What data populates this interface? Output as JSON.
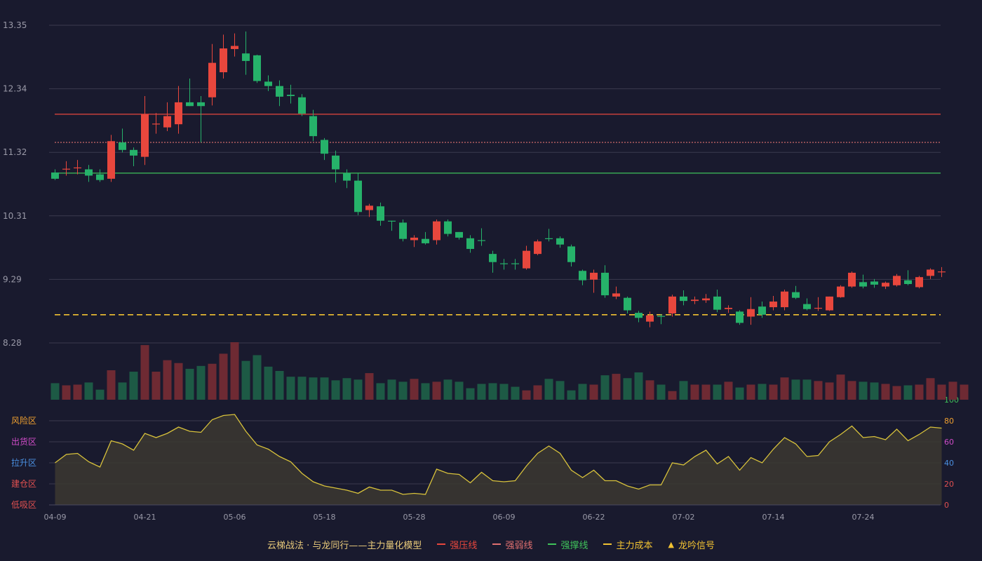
{
  "chart_data": {
    "type": "candlestick",
    "price_axis": {
      "ticks": [
        "13.35",
        "12.34",
        "11.32",
        "10.31",
        "9.29",
        "8.28"
      ],
      "ylim": [
        8.28,
        13.35
      ]
    },
    "x_ticks": [
      {
        "label": "04-09",
        "index": 0
      },
      {
        "label": "04-21",
        "index": 8
      },
      {
        "label": "05-06",
        "index": 16
      },
      {
        "label": "05-18",
        "index": 24
      },
      {
        "label": "05-28",
        "index": 32
      },
      {
        "label": "06-09",
        "index": 40
      },
      {
        "label": "06-22",
        "index": 48
      },
      {
        "label": "07-02",
        "index": 56
      },
      {
        "label": "07-14",
        "index": 64
      },
      {
        "label": "07-24",
        "index": 72
      }
    ],
    "candles": [
      [
        11.0,
        10.9,
        11.05,
        10.88,
        "dn"
      ],
      [
        11.05,
        11.06,
        11.18,
        10.95,
        "up"
      ],
      [
        11.07,
        11.08,
        11.2,
        10.97,
        "up"
      ],
      [
        11.05,
        10.95,
        11.12,
        10.85,
        "dn"
      ],
      [
        10.97,
        10.88,
        11.05,
        10.85,
        "dn"
      ],
      [
        10.9,
        11.5,
        11.6,
        10.85,
        "up"
      ],
      [
        11.48,
        11.36,
        11.7,
        11.32,
        "dn"
      ],
      [
        11.36,
        11.27,
        11.4,
        11.1,
        "dn"
      ],
      [
        11.25,
        11.93,
        12.22,
        11.12,
        "up"
      ],
      [
        11.77,
        11.78,
        11.95,
        11.62,
        "up"
      ],
      [
        11.72,
        11.9,
        12.12,
        11.66,
        "up"
      ],
      [
        11.77,
        12.12,
        12.38,
        11.62,
        "up"
      ],
      [
        12.12,
        12.06,
        12.5,
        12.06,
        "dn"
      ],
      [
        12.12,
        12.06,
        12.22,
        11.48,
        "dn"
      ],
      [
        12.2,
        12.75,
        13.05,
        12.07,
        "up"
      ],
      [
        12.6,
        12.98,
        13.2,
        12.5,
        "up"
      ],
      [
        12.97,
        13.02,
        13.22,
        12.85,
        "up"
      ],
      [
        12.9,
        12.78,
        13.25,
        12.56,
        "dn"
      ],
      [
        12.87,
        12.46,
        12.88,
        12.43,
        "dn"
      ],
      [
        12.45,
        12.38,
        12.55,
        12.3,
        "dn"
      ],
      [
        12.38,
        12.21,
        12.47,
        12.06,
        "dn"
      ],
      [
        12.24,
        12.22,
        12.4,
        12.1,
        "dn"
      ],
      [
        12.2,
        11.94,
        12.25,
        11.9,
        "dn"
      ],
      [
        11.9,
        11.58,
        12.0,
        11.5,
        "dn"
      ],
      [
        11.52,
        11.3,
        11.55,
        11.2,
        "dn"
      ],
      [
        11.27,
        11.05,
        11.35,
        10.84,
        "dn"
      ],
      [
        10.99,
        10.87,
        11.05,
        10.75,
        "dn"
      ],
      [
        10.87,
        10.37,
        10.99,
        10.32,
        "dn"
      ],
      [
        10.4,
        10.47,
        10.5,
        10.29,
        "up"
      ],
      [
        10.46,
        10.23,
        10.52,
        10.15,
        "dn"
      ],
      [
        10.23,
        10.22,
        10.23,
        10.07,
        "dn"
      ],
      [
        10.2,
        9.94,
        10.25,
        9.9,
        "dn"
      ],
      [
        9.92,
        9.96,
        10.0,
        9.81,
        "up"
      ],
      [
        9.94,
        9.87,
        10.05,
        9.85,
        "dn"
      ],
      [
        9.92,
        10.22,
        10.25,
        9.85,
        "up"
      ],
      [
        10.22,
        10.02,
        10.25,
        9.98,
        "dn"
      ],
      [
        10.05,
        9.96,
        10.05,
        9.93,
        "dn"
      ],
      [
        9.95,
        9.78,
        10.0,
        9.72,
        "dn"
      ],
      [
        9.92,
        9.92,
        10.11,
        9.83,
        "dn"
      ],
      [
        9.7,
        9.57,
        9.75,
        9.4,
        "dn"
      ],
      [
        9.55,
        9.55,
        9.62,
        9.45,
        "dn"
      ],
      [
        9.55,
        9.55,
        9.62,
        9.45,
        "dn"
      ],
      [
        9.47,
        9.75,
        9.83,
        9.45,
        "up"
      ],
      [
        9.7,
        9.9,
        9.93,
        9.68,
        "up"
      ],
      [
        9.95,
        9.94,
        10.1,
        9.9,
        "dn"
      ],
      [
        9.95,
        9.85,
        9.98,
        9.8,
        "dn"
      ],
      [
        9.82,
        9.57,
        9.85,
        9.5,
        "dn"
      ],
      [
        9.43,
        9.28,
        9.45,
        9.2,
        "dn"
      ],
      [
        9.29,
        9.4,
        9.45,
        9.08,
        "up"
      ],
      [
        9.4,
        9.04,
        9.52,
        9.0,
        "dn"
      ],
      [
        9.02,
        9.07,
        9.18,
        8.98,
        "up"
      ],
      [
        9.0,
        8.8,
        9.02,
        8.75,
        "dn"
      ],
      [
        8.76,
        8.68,
        8.79,
        8.61,
        "dn"
      ],
      [
        8.62,
        8.72,
        8.78,
        8.53,
        "up"
      ],
      [
        8.71,
        8.7,
        8.74,
        8.58,
        "dn"
      ],
      [
        8.75,
        9.02,
        9.05,
        8.7,
        "up"
      ],
      [
        8.95,
        9.02,
        9.12,
        8.88,
        "dn"
      ],
      [
        8.95,
        8.97,
        9.02,
        8.9,
        "up"
      ],
      [
        8.96,
        8.99,
        9.06,
        8.92,
        "up"
      ],
      [
        9.02,
        8.81,
        9.13,
        8.77,
        "dn"
      ],
      [
        8.82,
        8.84,
        8.88,
        8.76,
        "up"
      ],
      [
        8.78,
        8.6,
        8.8,
        8.57,
        "dn"
      ],
      [
        8.7,
        8.82,
        9.01,
        8.57,
        "up"
      ],
      [
        8.73,
        8.86,
        8.94,
        8.68,
        "dn"
      ],
      [
        8.85,
        8.94,
        9.03,
        8.8,
        "up"
      ],
      [
        8.85,
        9.1,
        9.13,
        8.8,
        "up"
      ],
      [
        9.09,
        9.0,
        9.19,
        8.98,
        "dn"
      ],
      [
        8.9,
        8.82,
        8.99,
        8.8,
        "dn"
      ],
      [
        8.83,
        8.84,
        9.01,
        8.79,
        "up"
      ],
      [
        8.8,
        9.02,
        9.02,
        8.79,
        "up"
      ],
      [
        9.01,
        9.18,
        9.2,
        9.0,
        "up"
      ],
      [
        9.18,
        9.4,
        9.42,
        9.16,
        "up"
      ],
      [
        9.25,
        9.18,
        9.37,
        9.15,
        "dn"
      ],
      [
        9.26,
        9.21,
        9.3,
        9.16,
        "dn"
      ],
      [
        9.18,
        9.24,
        9.26,
        9.14,
        "up"
      ],
      [
        9.2,
        9.35,
        9.38,
        9.18,
        "up"
      ],
      [
        9.28,
        9.22,
        9.44,
        9.2,
        "dn"
      ],
      [
        9.17,
        9.33,
        9.35,
        9.15,
        "up"
      ],
      [
        9.35,
        9.45,
        9.47,
        9.3,
        "up"
      ],
      [
        9.41,
        9.42,
        9.49,
        9.33,
        "up"
      ]
    ],
    "volume": [
      23,
      20,
      21,
      24,
      14,
      41,
      24,
      39,
      76,
      39,
      55,
      51,
      43,
      47,
      50,
      64,
      80,
      54,
      62,
      46,
      40,
      32,
      32,
      31,
      31,
      27,
      30,
      28,
      37,
      23,
      28,
      25,
      29,
      23,
      25,
      28,
      25,
      16,
      22,
      23,
      22,
      18,
      13,
      20,
      29,
      26,
      13,
      22,
      21,
      34,
      36,
      30,
      38,
      27,
      21,
      12,
      26,
      21,
      21,
      21,
      25,
      17,
      21,
      22,
      21,
      31,
      28,
      28,
      26,
      24,
      35,
      26,
      25,
      24,
      22,
      19,
      20,
      21,
      30,
      21,
      25,
      21
    ],
    "indicator": {
      "axis_ticks": [
        "100",
        "80",
        "60",
        "40",
        "20",
        "0"
      ],
      "zones": [
        "风险区",
        "出货区",
        "拉升区",
        "建仓区",
        "低吸区"
      ],
      "values": [
        40,
        48,
        49,
        41,
        36,
        61,
        58,
        52,
        68,
        64,
        68,
        74,
        70,
        69,
        81,
        85,
        86,
        70,
        57,
        53,
        46,
        41,
        30,
        22,
        18,
        16,
        14,
        11,
        17,
        14,
        14,
        10,
        11,
        10,
        34,
        30,
        29,
        21,
        31,
        23,
        22,
        23,
        37,
        49,
        56,
        49,
        33,
        26,
        33,
        23,
        23,
        18,
        15,
        19,
        19,
        40,
        38,
        46,
        52,
        39,
        46,
        33,
        45,
        40,
        53,
        64,
        58,
        46,
        47,
        60,
        67,
        75,
        64,
        65,
        62,
        72,
        61,
        67,
        74,
        73
      ]
    },
    "lines": [
      {
        "key": "strong_pressure",
        "value": 11.93,
        "color": "#e8473d",
        "style": "solid"
      },
      {
        "key": "strong_weak",
        "value": 11.48,
        "color": "#e07070",
        "style": "dotted"
      },
      {
        "key": "strong_support",
        "value": 10.99,
        "color": "#3fc25a",
        "style": "solid"
      },
      {
        "key": "main_cost",
        "value": 8.73,
        "color": "#f1c232",
        "style": "dashed"
      }
    ],
    "legend": {
      "title": "云梯战法 · 与龙同行——主力量化模型",
      "items": [
        {
          "label": "强压线",
          "color": "#e8473d",
          "style": "solid"
        },
        {
          "label": "强弱线",
          "color": "#e07070",
          "style": "dashed"
        },
        {
          "label": "强撑线",
          "color": "#3fc25a",
          "style": "solid"
        },
        {
          "label": "主力成本",
          "color": "#f1c232",
          "style": "dashed"
        },
        {
          "label": "龙吟信号",
          "color": "#f1c232",
          "style": "triangle"
        }
      ]
    },
    "colors": {
      "up": "#e8473d",
      "down": "#26b26a",
      "vol_up": "#6e2a33",
      "vol_down": "#1d5a45",
      "indicator_line": "#d8c23b",
      "indicator_fill": "#3c3830",
      "grid": "#3a3b4f",
      "axis_text": "#9a9aa8",
      "zone_colors": [
        "#f0a030",
        "#d04cc8",
        "#4a90e2",
        "#e05050",
        "#e05050"
      ],
      "indicator_tick_colors": [
        "#3fc25a",
        "#f0a030",
        "#d04cc8",
        "#4a90e2",
        "#e05050",
        "#e05050"
      ]
    }
  }
}
